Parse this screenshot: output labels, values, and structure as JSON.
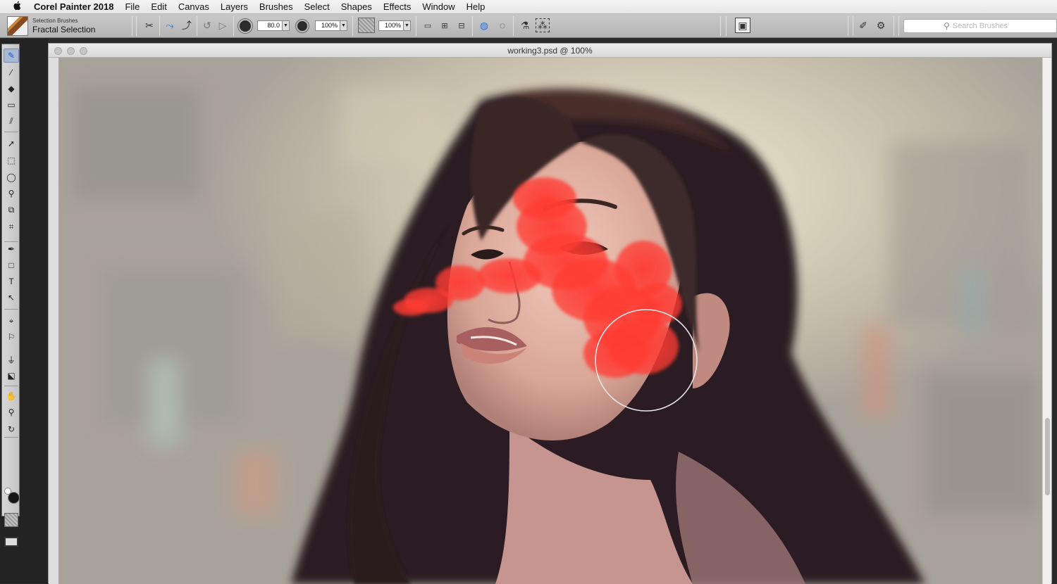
{
  "menubar": {
    "apple": "",
    "app_name": "Corel Painter 2018",
    "items": [
      "File",
      "Edit",
      "Canvas",
      "Layers",
      "Brushes",
      "Select",
      "Shapes",
      "Effects",
      "Window",
      "Help"
    ]
  },
  "property_bar": {
    "brush_category": "Selection Brushes",
    "brush_variant": "Fractal Selection",
    "size_value": "80.0",
    "opacity_value": "100%",
    "grain_value": "100%",
    "search_placeholder": "Search Brushes"
  },
  "document": {
    "title": "working3.psd @ 100%"
  },
  "toolbox": {
    "tools": [
      {
        "name": "brush-tool-icon",
        "glyph": "✎",
        "active": true
      },
      {
        "name": "dropper-tool-icon",
        "glyph": "⁄",
        "active": false
      },
      {
        "name": "paint-bucket-tool-icon",
        "glyph": "◆",
        "active": false
      },
      {
        "name": "eraser-tool-icon",
        "glyph": "▭",
        "active": false
      },
      {
        "name": "cloner-tool-icon",
        "glyph": "⫽",
        "active": false
      },
      {
        "name": "layer-adjuster-tool-icon",
        "glyph": "➚",
        "active": false
      },
      {
        "name": "rectangular-selection-tool-icon",
        "glyph": "⬚",
        "active": false
      },
      {
        "name": "lasso-tool-icon",
        "glyph": "◯",
        "active": false
      },
      {
        "name": "magic-wand-tool-icon",
        "glyph": "⚲",
        "active": false
      },
      {
        "name": "transform-tool-icon",
        "glyph": "⧉",
        "active": false
      },
      {
        "name": "crop-tool-icon",
        "glyph": "⌗",
        "active": false
      },
      {
        "name": "pen-tool-icon",
        "glyph": "✒",
        "active": false
      },
      {
        "name": "rectangle-shape-tool-icon",
        "glyph": "□",
        "active": false
      },
      {
        "name": "text-tool-icon",
        "glyph": "T",
        "active": false
      },
      {
        "name": "shape-selection-tool-icon",
        "glyph": "↖",
        "active": false
      },
      {
        "name": "perspective-guides-tool-icon",
        "glyph": "⌖",
        "active": false
      },
      {
        "name": "dodge-tool-icon",
        "glyph": "⚐",
        "active": false
      },
      {
        "name": "mirror-painting-tool-icon",
        "glyph": "⏚",
        "active": false
      },
      {
        "name": "divine-proportion-tool-icon",
        "glyph": "⬕",
        "active": false
      },
      {
        "name": "grabber-hand-tool-icon",
        "glyph": "✋",
        "active": false
      },
      {
        "name": "magnifier-tool-icon",
        "glyph": "⚲",
        "active": false
      },
      {
        "name": "rotate-page-tool-icon",
        "glyph": "↻",
        "active": false
      }
    ]
  },
  "colors": {
    "main_color": "#151515",
    "additional_color": "#ffffff",
    "selection_mask": "#ff3b33",
    "active_tool_bg": "#a9b9d3"
  }
}
